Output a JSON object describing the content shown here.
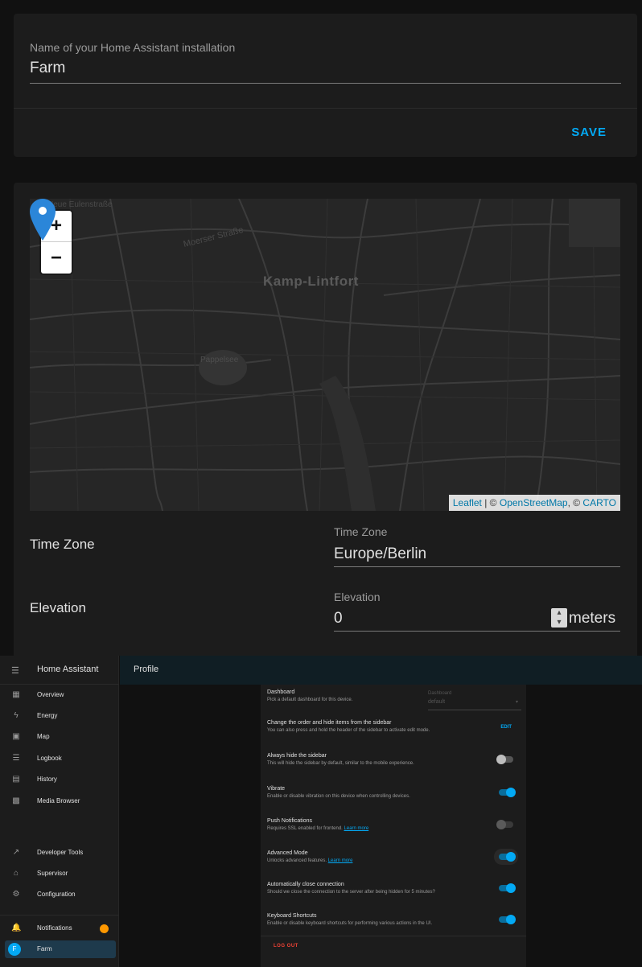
{
  "general": {
    "name_label": "Name of your Home Assistant installation",
    "name_value": "Farm",
    "save_label": "SAVE"
  },
  "map": {
    "zoom_in": "+",
    "zoom_out": "−",
    "city_label": "Kamp-Lintfort",
    "street_label": "Moerser Straße",
    "street_label_2": "Neue Eulenstraße",
    "park_label": "Pappelsee",
    "attribution": {
      "leaflet": "Leaflet",
      "sep1": " | © ",
      "osm": "OpenStreetMap",
      "sep2": ", © ",
      "carto": "CARTO"
    },
    "marker_icon": "map-marker-icon"
  },
  "timezone": {
    "row_label": "Time Zone",
    "field_label": "Time Zone",
    "value": "Europe/Berlin"
  },
  "elevation": {
    "row_label": "Elevation",
    "field_label": "Elevation",
    "value": "0",
    "unit": "meters"
  },
  "sidebar": {
    "title": "Home Assistant",
    "menu_icon": "menu-icon",
    "items": [
      {
        "label": "Overview",
        "icon": "▦"
      },
      {
        "label": "Energy",
        "icon": "ϟ"
      },
      {
        "label": "Map",
        "icon": "▣"
      },
      {
        "label": "Logbook",
        "icon": "☰"
      },
      {
        "label": "History",
        "icon": "▤"
      },
      {
        "label": "Media Browser",
        "icon": "▩"
      }
    ],
    "lower_items": [
      {
        "label": "Developer Tools",
        "icon": "↗"
      },
      {
        "label": "Supervisor",
        "icon": "⌂"
      },
      {
        "label": "Configuration",
        "icon": "⚙"
      }
    ],
    "notifications": {
      "label": "Notifications",
      "icon": "🔔"
    },
    "user": {
      "initial": "F",
      "label": "Farm"
    }
  },
  "profile": {
    "title": "Profile",
    "dashboard": {
      "title": "Dashboard",
      "desc": "Pick a default dashboard for this device.",
      "select_label": "Dashboard",
      "select_value": "default"
    },
    "sidebar_order": {
      "title": "Change the order and hide items from the sidebar",
      "desc": "You can also press and hold the header of the sidebar to activate edit mode.",
      "edit_label": "EDIT"
    },
    "always_hide": {
      "title": "Always hide the sidebar",
      "desc": "This will hide the sidebar by default, similar to the mobile experience.",
      "state": "off"
    },
    "vibrate": {
      "title": "Vibrate",
      "desc": "Enable or disable vibration on this device when controlling devices.",
      "state": "on"
    },
    "push": {
      "title": "Push Notifications",
      "desc": "Requires SSL enabled for frontend.",
      "link": "Learn more",
      "state": "disabled"
    },
    "advanced": {
      "title": "Advanced Mode",
      "desc": "Unlocks advanced features.",
      "link": "Learn more",
      "state": "on"
    },
    "auto_close": {
      "title": "Automatically close connection",
      "desc": "Should we close the connection to the server after being hidden for 5 minutes?",
      "state": "on"
    },
    "keyboard": {
      "title": "Keyboard Shortcuts",
      "desc": "Enable or disable keyboard shortcuts for performing various actions in the UI.",
      "state": "on"
    },
    "logout_label": "LOG OUT"
  },
  "colors": {
    "accent": "#03a9f4",
    "background": "#111111",
    "card": "#1c1c1c",
    "badge": "#ff9800",
    "danger": "#f44336"
  }
}
